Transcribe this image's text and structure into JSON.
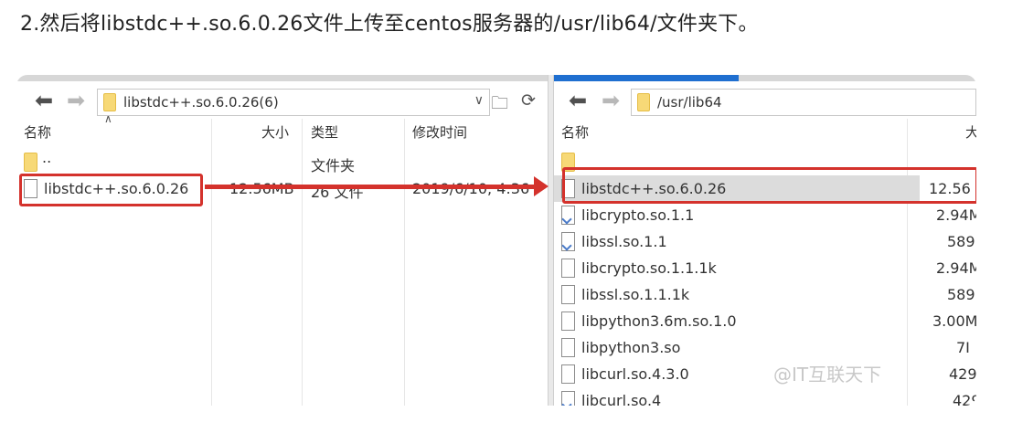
{
  "heading": "2.然后将libstdc++.so.6.0.26文件上传至centos服务器的/usr/lib64/文件夹下。",
  "left_pane": {
    "path": "libstdc++.so.6.0.26(6)",
    "columns": {
      "name": "名称",
      "size": "大小",
      "type": "类型",
      "modified": "修改时间"
    },
    "rows": [
      {
        "name": "..",
        "size": "",
        "type": "文件夹",
        "modified": "",
        "icon": "folder-icon"
      },
      {
        "name": "libstdc++.so.6.0.26",
        "size": "12.56MB",
        "type": "26 文件",
        "modified": "2019/6/10, 4:36",
        "icon": "file-icon"
      }
    ]
  },
  "right_pane": {
    "path": "/usr/lib64",
    "columns": {
      "name": "名称",
      "size": "大"
    },
    "rows": [
      {
        "name": "..",
        "size": "",
        "icon": "folder-icon"
      },
      {
        "name": "libstdc++.so.6.0.26",
        "size": "12.56",
        "icon": "file-icon"
      },
      {
        "name": "libcrypto.so.1.1",
        "size": "2.94M",
        "icon": "symlink-file-icon"
      },
      {
        "name": "libssl.so.1.1",
        "size": "589I",
        "icon": "symlink-file-icon"
      },
      {
        "name": "libcrypto.so.1.1.1k",
        "size": "2.94M",
        "icon": "file-icon"
      },
      {
        "name": "libssl.so.1.1.1k",
        "size": "589I",
        "icon": "file-icon"
      },
      {
        "name": "libpython3.6m.so.1.0",
        "size": "3.00M",
        "icon": "file-icon"
      },
      {
        "name": "libpython3.so",
        "size": "7I",
        "icon": "file-icon"
      },
      {
        "name": "libcurl.so.4.3.0",
        "size": "429I",
        "icon": "file-icon"
      },
      {
        "name": "libcurl.so.4",
        "size": "429",
        "icon": "symlink-file-icon"
      }
    ]
  },
  "watermark": "@IT互联天下",
  "colors": {
    "highlight": "#d4322c",
    "active_tab": "#1f6fd0",
    "selected_row": "#dcdcdc"
  }
}
